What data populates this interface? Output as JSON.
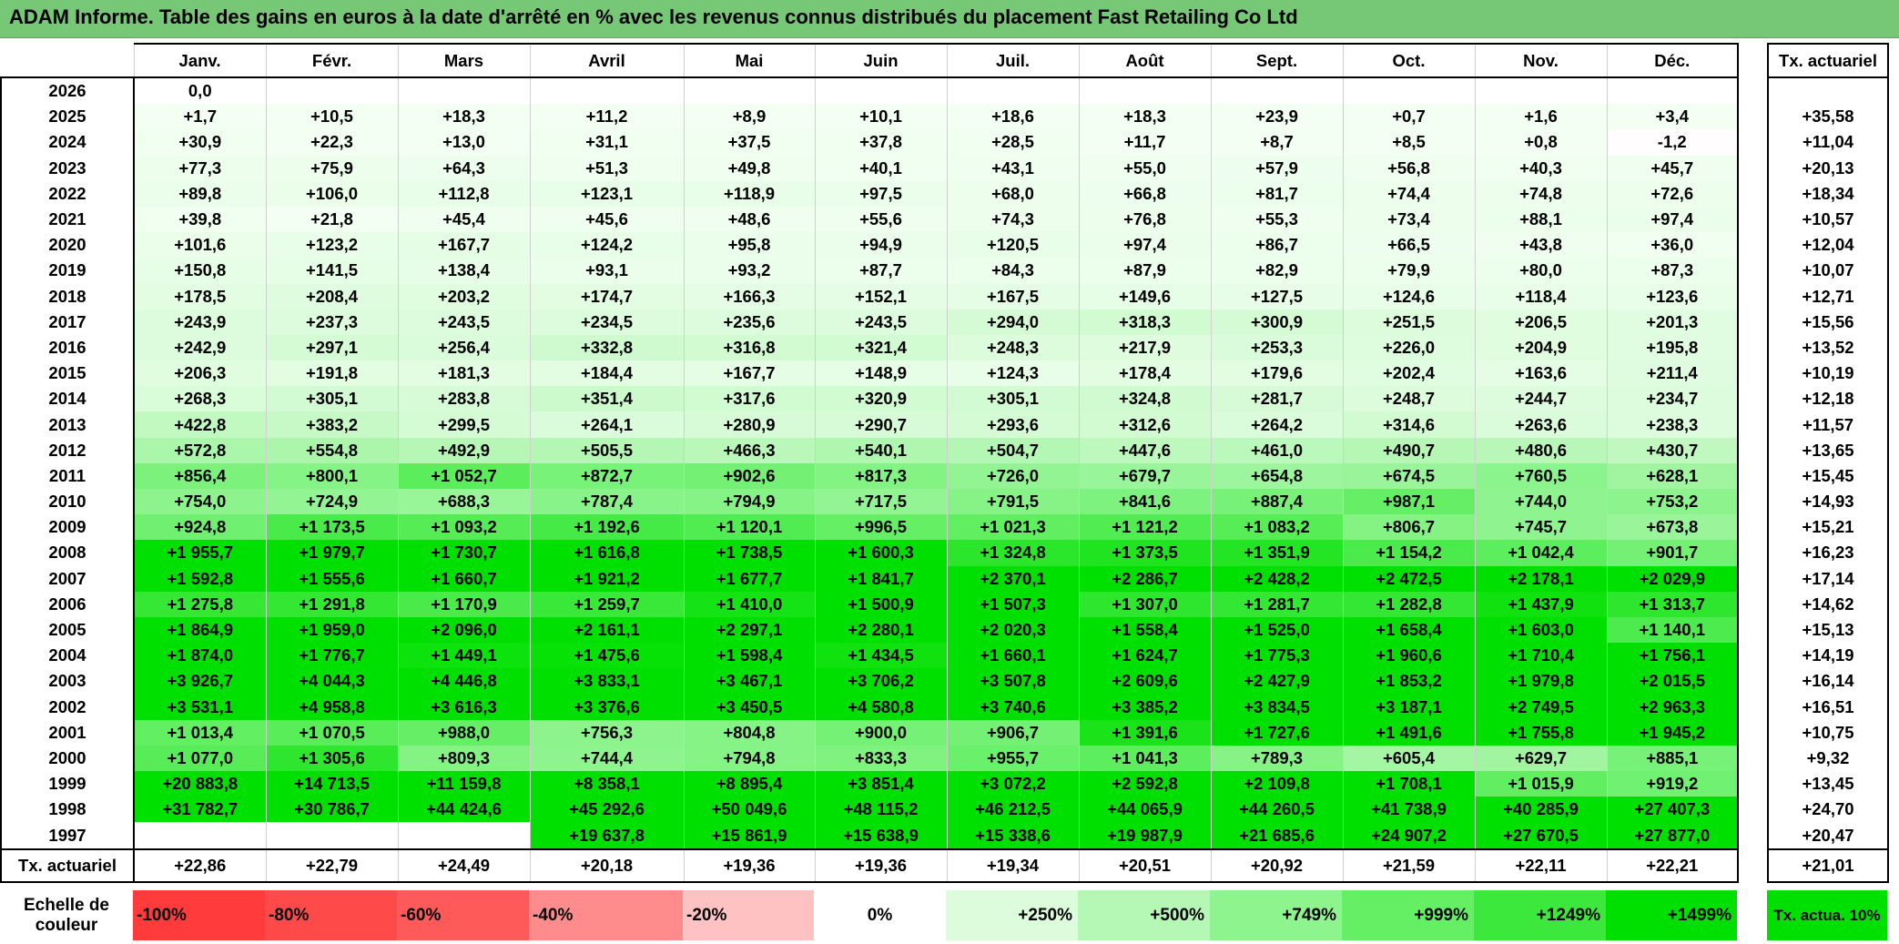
{
  "title": "ADAM Informe. Table des gains en euros à la date d'arrêté en % avec les revenus connus distribués du placement Fast Retailing Co Ltd",
  "chart_data": {
    "type": "table",
    "title": "ADAM Informe. Table des gains en euros à la date d'arrêté en % avec les revenus connus distribués du placement Fast Retailing Co Ltd",
    "months": [
      "Janv.",
      "Févr.",
      "Mars",
      "Avril",
      "Mai",
      "Juin",
      "Juil.",
      "Août",
      "Sept.",
      "Oct.",
      "Nov.",
      "Déc."
    ],
    "tx_header": "Tx. actuariel",
    "rows": [
      {
        "year": "2026",
        "values": [
          "0,0",
          "",
          "",
          "",
          "",
          "",
          "",
          "",
          "",
          "",
          "",
          ""
        ],
        "tx": ""
      },
      {
        "year": "2025",
        "values": [
          "+1,7",
          "+10,5",
          "+18,3",
          "+11,2",
          "+8,9",
          "+10,1",
          "+18,6",
          "+18,3",
          "+23,9",
          "+0,7",
          "+1,6",
          "+3,4"
        ],
        "tx": "+35,58"
      },
      {
        "year": "2024",
        "values": [
          "+30,9",
          "+22,3",
          "+13,0",
          "+31,1",
          "+37,5",
          "+37,8",
          "+28,5",
          "+11,7",
          "+8,7",
          "+8,5",
          "+0,8",
          "-1,2"
        ],
        "tx": "+11,04"
      },
      {
        "year": "2023",
        "values": [
          "+77,3",
          "+75,9",
          "+64,3",
          "+51,3",
          "+49,8",
          "+40,1",
          "+43,1",
          "+55,0",
          "+57,9",
          "+56,8",
          "+40,3",
          "+45,7"
        ],
        "tx": "+20,13"
      },
      {
        "year": "2022",
        "values": [
          "+89,8",
          "+106,0",
          "+112,8",
          "+123,1",
          "+118,9",
          "+97,5",
          "+68,0",
          "+66,8",
          "+81,7",
          "+74,4",
          "+74,8",
          "+72,6"
        ],
        "tx": "+18,34"
      },
      {
        "year": "2021",
        "values": [
          "+39,8",
          "+21,8",
          "+45,4",
          "+45,6",
          "+48,6",
          "+55,6",
          "+74,3",
          "+76,8",
          "+55,3",
          "+73,4",
          "+88,1",
          "+97,4"
        ],
        "tx": "+10,57"
      },
      {
        "year": "2020",
        "values": [
          "+101,6",
          "+123,2",
          "+167,7",
          "+124,2",
          "+95,8",
          "+94,9",
          "+120,5",
          "+97,4",
          "+86,7",
          "+66,5",
          "+43,8",
          "+36,0"
        ],
        "tx": "+12,04"
      },
      {
        "year": "2019",
        "values": [
          "+150,8",
          "+141,5",
          "+138,4",
          "+93,1",
          "+93,2",
          "+87,7",
          "+84,3",
          "+87,9",
          "+82,9",
          "+79,9",
          "+80,0",
          "+87,3"
        ],
        "tx": "+10,07"
      },
      {
        "year": "2018",
        "values": [
          "+178,5",
          "+208,4",
          "+203,2",
          "+174,7",
          "+166,3",
          "+152,1",
          "+167,5",
          "+149,6",
          "+127,5",
          "+124,6",
          "+118,4",
          "+123,6"
        ],
        "tx": "+12,71"
      },
      {
        "year": "2017",
        "values": [
          "+243,9",
          "+237,3",
          "+243,5",
          "+234,5",
          "+235,6",
          "+243,5",
          "+294,0",
          "+318,3",
          "+300,9",
          "+251,5",
          "+206,5",
          "+201,3"
        ],
        "tx": "+15,56"
      },
      {
        "year": "2016",
        "values": [
          "+242,9",
          "+297,1",
          "+256,4",
          "+332,8",
          "+316,8",
          "+321,4",
          "+248,3",
          "+217,9",
          "+253,3",
          "+226,0",
          "+204,9",
          "+195,8"
        ],
        "tx": "+13,52"
      },
      {
        "year": "2015",
        "values": [
          "+206,3",
          "+191,8",
          "+181,3",
          "+184,4",
          "+167,7",
          "+148,9",
          "+124,3",
          "+178,4",
          "+179,6",
          "+202,4",
          "+163,6",
          "+211,4"
        ],
        "tx": "+10,19"
      },
      {
        "year": "2014",
        "values": [
          "+268,3",
          "+305,1",
          "+283,8",
          "+351,4",
          "+317,6",
          "+320,9",
          "+305,1",
          "+324,8",
          "+281,7",
          "+248,7",
          "+244,7",
          "+234,7"
        ],
        "tx": "+12,18"
      },
      {
        "year": "2013",
        "values": [
          "+422,8",
          "+383,2",
          "+299,5",
          "+264,1",
          "+280,9",
          "+290,7",
          "+293,6",
          "+312,6",
          "+264,2",
          "+314,6",
          "+263,6",
          "+238,3"
        ],
        "tx": "+11,57"
      },
      {
        "year": "2012",
        "values": [
          "+572,8",
          "+554,8",
          "+492,9",
          "+505,5",
          "+466,3",
          "+540,1",
          "+504,7",
          "+447,6",
          "+461,0",
          "+490,7",
          "+480,6",
          "+430,7"
        ],
        "tx": "+13,65"
      },
      {
        "year": "2011",
        "values": [
          "+856,4",
          "+800,1",
          "+1 052,7",
          "+872,7",
          "+902,6",
          "+817,3",
          "+726,0",
          "+679,7",
          "+654,8",
          "+674,5",
          "+760,5",
          "+628,1"
        ],
        "tx": "+15,45"
      },
      {
        "year": "2010",
        "values": [
          "+754,0",
          "+724,9",
          "+688,3",
          "+787,4",
          "+794,9",
          "+717,5",
          "+791,5",
          "+841,6",
          "+887,4",
          "+987,1",
          "+744,0",
          "+753,2"
        ],
        "tx": "+14,93"
      },
      {
        "year": "2009",
        "values": [
          "+924,8",
          "+1 173,5",
          "+1 093,2",
          "+1 192,6",
          "+1 120,1",
          "+996,5",
          "+1 021,3",
          "+1 121,2",
          "+1 083,2",
          "+806,7",
          "+745,7",
          "+673,8"
        ],
        "tx": "+15,21"
      },
      {
        "year": "2008",
        "values": [
          "+1 955,7",
          "+1 979,7",
          "+1 730,7",
          "+1 616,8",
          "+1 738,5",
          "+1 600,3",
          "+1 324,8",
          "+1 373,5",
          "+1 351,9",
          "+1 154,2",
          "+1 042,4",
          "+901,7"
        ],
        "tx": "+16,23"
      },
      {
        "year": "2007",
        "values": [
          "+1 592,8",
          "+1 555,6",
          "+1 660,7",
          "+1 921,2",
          "+1 677,7",
          "+1 841,7",
          "+2 370,1",
          "+2 286,7",
          "+2 428,2",
          "+2 472,5",
          "+2 178,1",
          "+2 029,9"
        ],
        "tx": "+17,14"
      },
      {
        "year": "2006",
        "values": [
          "+1 275,8",
          "+1 291,8",
          "+1 170,9",
          "+1 259,7",
          "+1 410,0",
          "+1 500,9",
          "+1 507,3",
          "+1 307,0",
          "+1 281,7",
          "+1 282,8",
          "+1 437,9",
          "+1 313,7"
        ],
        "tx": "+14,62"
      },
      {
        "year": "2005",
        "values": [
          "+1 864,9",
          "+1 959,0",
          "+2 096,0",
          "+2 161,1",
          "+2 297,1",
          "+2 280,1",
          "+2 020,3",
          "+1 558,4",
          "+1 525,0",
          "+1 658,4",
          "+1 603,0",
          "+1 140,1"
        ],
        "tx": "+15,13"
      },
      {
        "year": "2004",
        "values": [
          "+1 874,0",
          "+1 776,7",
          "+1 449,1",
          "+1 475,6",
          "+1 598,4",
          "+1 434,5",
          "+1 660,1",
          "+1 624,7",
          "+1 775,3",
          "+1 960,6",
          "+1 710,4",
          "+1 756,1"
        ],
        "tx": "+14,19"
      },
      {
        "year": "2003",
        "values": [
          "+3 926,7",
          "+4 044,3",
          "+4 446,8",
          "+3 833,1",
          "+3 467,1",
          "+3 706,2",
          "+3 507,8",
          "+2 609,6",
          "+2 427,9",
          "+1 853,2",
          "+1 979,8",
          "+2 015,5"
        ],
        "tx": "+16,14"
      },
      {
        "year": "2002",
        "values": [
          "+3 531,1",
          "+4 958,8",
          "+3 616,3",
          "+3 376,6",
          "+3 450,5",
          "+4 580,8",
          "+3 740,6",
          "+3 385,2",
          "+3 834,5",
          "+3 187,1",
          "+2 749,5",
          "+2 963,3"
        ],
        "tx": "+16,51"
      },
      {
        "year": "2001",
        "values": [
          "+1 013,4",
          "+1 070,5",
          "+988,0",
          "+756,3",
          "+804,8",
          "+900,0",
          "+906,7",
          "+1 391,6",
          "+1 727,6",
          "+1 491,6",
          "+1 755,8",
          "+1 945,2"
        ],
        "tx": "+10,75"
      },
      {
        "year": "2000",
        "values": [
          "+1 077,0",
          "+1 305,6",
          "+809,3",
          "+744,4",
          "+794,8",
          "+833,3",
          "+955,7",
          "+1 041,3",
          "+789,3",
          "+605,4",
          "+629,7",
          "+885,1"
        ],
        "tx": "+9,32"
      },
      {
        "year": "1999",
        "values": [
          "+20 883,8",
          "+14 713,5",
          "+11 159,8",
          "+8 358,1",
          "+8 895,4",
          "+3 851,4",
          "+3 072,2",
          "+2 592,8",
          "+2 109,8",
          "+1 708,1",
          "+1 015,9",
          "+919,2"
        ],
        "tx": "+13,45"
      },
      {
        "year": "1998",
        "values": [
          "+31 782,7",
          "+30 786,7",
          "+44 424,6",
          "+45 292,6",
          "+50 049,6",
          "+48 115,2",
          "+46 212,5",
          "+44 065,9",
          "+44 260,5",
          "+41 738,9",
          "+40 285,9",
          "+27 407,3"
        ],
        "tx": "+24,70"
      },
      {
        "year": "1997",
        "values": [
          "",
          "",
          "",
          "+19 637,8",
          "+15 861,9",
          "+15 638,9",
          "+15 338,6",
          "+19 987,9",
          "+21 685,6",
          "+24 907,2",
          "+27 670,5",
          "+27 877,0"
        ],
        "tx": "+20,47"
      }
    ],
    "footer": {
      "label": "Tx. actuariel",
      "values": [
        "+22,86",
        "+22,79",
        "+24,49",
        "+20,18",
        "+19,36",
        "+19,36",
        "+19,34",
        "+20,51",
        "+20,92",
        "+21,59",
        "+22,11",
        "+22,21"
      ],
      "tx": "+21,01"
    },
    "scale": {
      "label": "Echelle de couleur",
      "steps": [
        "-100%",
        "-80%",
        "-60%",
        "-40%",
        "-20%",
        "0%",
        "+250%",
        "+500%",
        "+749%",
        "+999%",
        "+1249%",
        "+1499%"
      ],
      "step_colors": [
        "#ff3b3b",
        "#ff4a4a",
        "#ff5a5a",
        "#ff8c8c",
        "#ffc2c2",
        "#ffffff",
        "#dcfcdc",
        "#b5f7b5",
        "#8ef48e",
        "#64ef64",
        "#3de83d",
        "#00e000"
      ],
      "tx_label": "Tx. actua. 10%",
      "tx_color": "#00e000"
    }
  }
}
